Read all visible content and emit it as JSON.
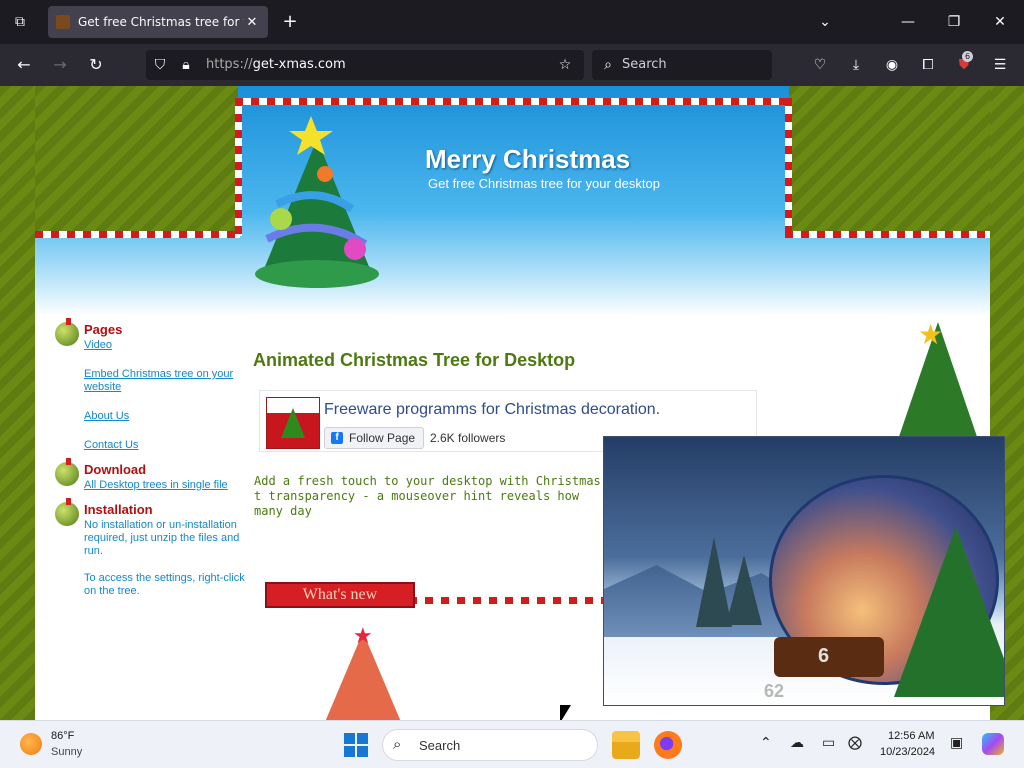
{
  "browser": {
    "tab_title": "Get free Christmas tree for your",
    "tab_close": "✕",
    "new_tab": "+",
    "url_protocol": "https://",
    "url_host": "get-xmas.com",
    "search_placeholder": "Search",
    "extension_badge": "6"
  },
  "banner": {
    "title": "Merry Christmas",
    "subtitle": "Get free Christmas tree for your desktop"
  },
  "sidebar": {
    "pages_heading": "Pages",
    "pages_links": [
      "Video",
      "Embed Christmas tree on your website",
      "About Us",
      "Contact Us"
    ],
    "download_heading": "Download",
    "download_link": "All Desktop trees in single file",
    "installation_heading": "Installation",
    "installation_text1": "No installation or un-installation required, just unzip the files and run.",
    "installation_text2": "To access the settings, right-click on the tree."
  },
  "main": {
    "heading": "Animated Christmas Tree for Desktop",
    "fb_title": "Freeware programms for Christmas decoration.",
    "fb_follow": "Follow Page",
    "fb_followers": "2.6K followers",
    "description": "Add a fresh touch to your desktop with Christmas t transparency - a mouseover hint reveals how many day",
    "whats_new": "What's new"
  },
  "widget": {
    "counter_top": "6",
    "counter_bottom": "62"
  },
  "taskbar": {
    "temperature": "86°F",
    "condition": "Sunny",
    "search": "Search",
    "time": "12:56 AM",
    "date": "10/23/2024"
  }
}
